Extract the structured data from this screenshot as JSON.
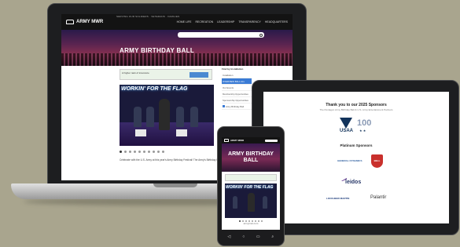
{
  "laptop_site": {
    "topbar_text": "SERVING OUR SOLDIERS · VETERANS · FAMILIES",
    "logo_text": "ARMY MWR",
    "menu": [
      "HOME LIFE",
      "RECREATION",
      "LEADERSHIP",
      "TRANSPARENCY",
      "HEADQUARTERS"
    ],
    "hero_title": "ARMY BIRTHDAY BALL",
    "ad_text": "A higher rank of insurance",
    "photo_text": "WORKIN' FOR THE FLAG",
    "caption": "Celebrate with the U.S. Army at this year's Army Birthday Festival! The Army's Birthday is a",
    "sidebar_heading": "Find by Installation",
    "sidebar_items": [
      "Installation",
      "OVERVIEW BALL ALL",
      "Our Events",
      "Membership Opportunities",
      "Sponsorship Opportunities",
      "Army Birthday Ball"
    ],
    "carousel_dot_count": 10,
    "carousel_active": 0
  },
  "tablet_site": {
    "thanks_title": "Thank you to our 2025 Sponsors",
    "thanks_sub": "The Pentagon Army Birthday Ball & U.S. Army Entertainment Partners",
    "usaa_text": "USAA",
    "usaa_100": "100",
    "usaa_stars": "★ ★",
    "platinum_title": "Platinum Sponsors",
    "general_dynamics": "GENERAL DYNAMICS",
    "bell": "BELL",
    "leidos": "leidos",
    "lockheed_martin": "LOCKHEED MARTIN",
    "palantir": "Palantir"
  },
  "phone_site": {
    "logo_text": "ARMY MWR",
    "hero_title": "ARMY BIRTHDAY BALL",
    "photo_text": "WORKIN' FOR THE FLAG",
    "footer_text": "armymwr.com",
    "carousel_dot_count": 8,
    "carousel_active": 0,
    "nav_buttons": [
      "◁",
      "○",
      "▭",
      "⌕"
    ]
  },
  "colors": {
    "background": "#a9a58e",
    "nav_dark": "#131313",
    "accent_blue": "#3a7bd5",
    "usaa_navy": "#12335b",
    "bell_red": "#c9302c"
  }
}
